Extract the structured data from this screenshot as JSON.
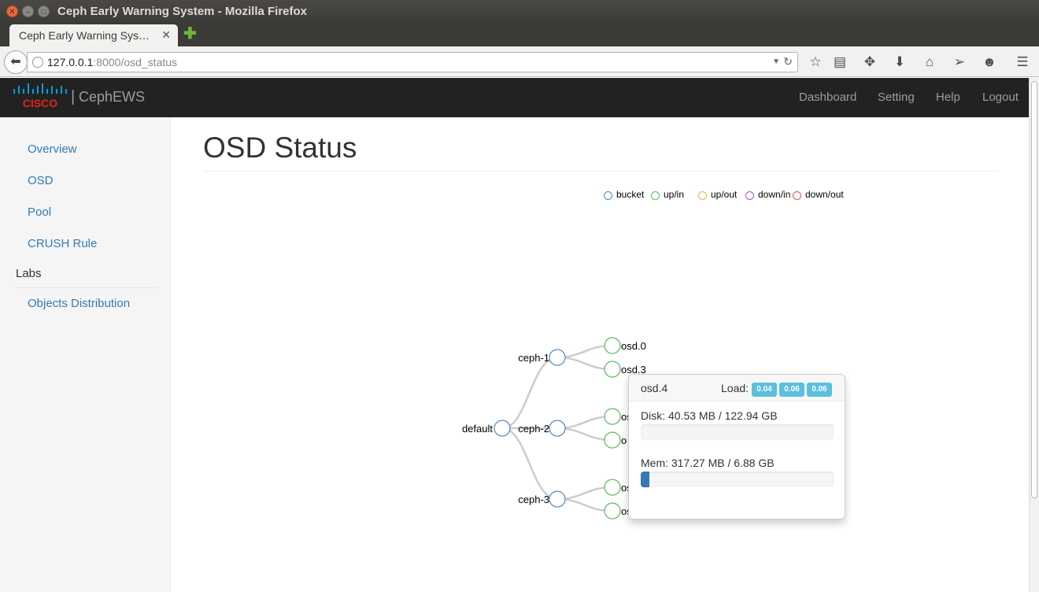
{
  "window": {
    "title": "Ceph Early Warning System - Mozilla Firefox"
  },
  "browser": {
    "tab_title": "Ceph Early Warning Sys…",
    "url_host": "127.0.0.1",
    "url_rest": ":8000/osd_status"
  },
  "header": {
    "logo_text": "CISCO",
    "separator": "|",
    "brand": "CephEWS",
    "nav": [
      "Dashboard",
      "Setting",
      "Help",
      "Logout"
    ]
  },
  "sidebar": {
    "items": [
      "Overview",
      "OSD",
      "Pool",
      "CRUSH Rule"
    ],
    "section": "Labs",
    "lab_items": [
      "Objects Distribution"
    ]
  },
  "page": {
    "title": "OSD Status"
  },
  "legend": [
    {
      "label": "bucket",
      "color": "#4a86c5"
    },
    {
      "label": "up/in",
      "color": "#5cb85c"
    },
    {
      "label": "up/out",
      "color": "#f0ad4e"
    },
    {
      "label": "down/in",
      "color": "#b050c8"
    },
    {
      "label": "down/out",
      "color": "#d9534f"
    }
  ],
  "tree": {
    "root": "default",
    "hosts": [
      {
        "name": "ceph-1",
        "osds": [
          "osd.0",
          "osd.3"
        ]
      },
      {
        "name": "ceph-2",
        "osds": [
          "os",
          "o"
        ]
      },
      {
        "name": "ceph-3",
        "osds": [
          "os",
          "os"
        ]
      }
    ]
  },
  "popover": {
    "osd": "osd.4",
    "load_label": "Load:",
    "load": [
      "0.04",
      "0.06",
      "0.06"
    ],
    "disk_label": "Disk: 40.53 MB / 122.94 GB",
    "disk_fraction": 0.0003,
    "mem_label": "Mem: 317.27 MB / 6.88 GB",
    "mem_fraction": 0.045
  }
}
